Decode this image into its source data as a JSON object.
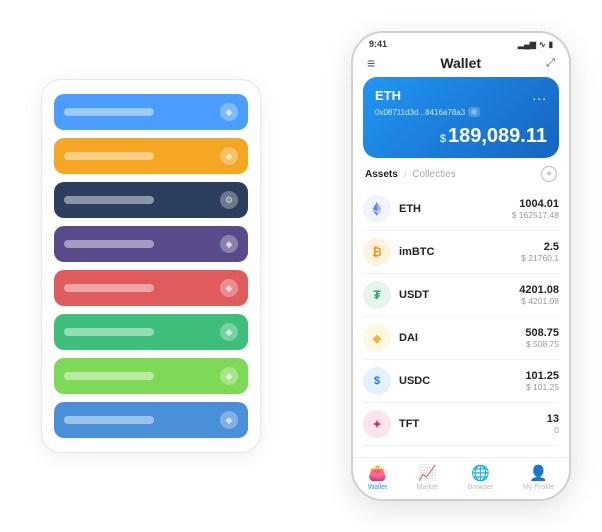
{
  "scene": {
    "background": "#ffffff"
  },
  "cardStack": {
    "items": [
      {
        "color": "si-blue",
        "label": "",
        "icon": "◆"
      },
      {
        "color": "si-orange",
        "label": "",
        "icon": "◆"
      },
      {
        "color": "si-dark",
        "label": "",
        "icon": "⚙"
      },
      {
        "color": "si-purple",
        "label": "",
        "icon": "◆"
      },
      {
        "color": "si-red",
        "label": "",
        "icon": "◆"
      },
      {
        "color": "si-green",
        "label": "",
        "icon": "◆"
      },
      {
        "color": "si-light-green",
        "label": "",
        "icon": "◆"
      },
      {
        "color": "si-blue2",
        "label": "",
        "icon": "◆"
      }
    ]
  },
  "phone": {
    "statusBar": {
      "time": "9:41",
      "signal": "▂▄▆",
      "wifi": "WiFi",
      "battery": "🔋"
    },
    "header": {
      "menuIcon": "≡",
      "title": "Wallet",
      "expandIcon": "⤢"
    },
    "ethCard": {
      "name": "ETH",
      "dotsMenu": "...",
      "address": "0x08711d3d...8416a78a3",
      "addressBadge": "⊞",
      "balanceCurrency": "$",
      "balance": "189,089.11"
    },
    "assetsTabs": {
      "active": "Assets",
      "separator": "/",
      "inactive": "Collecties"
    },
    "assetsAddIcon": "+",
    "assets": [
      {
        "name": "ETH",
        "iconChar": "◆",
        "iconClass": "icon-eth",
        "amount": "1004.01",
        "usd": "$ 162517.48"
      },
      {
        "name": "imBTC",
        "iconChar": "₿",
        "iconClass": "icon-imbtc",
        "amount": "2.5",
        "usd": "$ 21760.1"
      },
      {
        "name": "USDT",
        "iconChar": "₮",
        "iconClass": "icon-usdt",
        "amount": "4201.08",
        "usd": "$ 4201.08"
      },
      {
        "name": "DAI",
        "iconChar": "◈",
        "iconClass": "icon-dai",
        "amount": "508.75",
        "usd": "$ 508.75"
      },
      {
        "name": "USDC",
        "iconChar": "$",
        "iconClass": "icon-usdc",
        "amount": "101.25",
        "usd": "$ 101.25"
      },
      {
        "name": "TFT",
        "iconChar": "✦",
        "iconClass": "icon-tft",
        "amount": "13",
        "usd": "0"
      }
    ],
    "bottomNav": [
      {
        "icon": "👛",
        "label": "Wallet",
        "active": true
      },
      {
        "icon": "📈",
        "label": "Market",
        "active": false
      },
      {
        "icon": "🌐",
        "label": "Browser",
        "active": false
      },
      {
        "icon": "👤",
        "label": "My Profile",
        "active": false
      }
    ]
  }
}
